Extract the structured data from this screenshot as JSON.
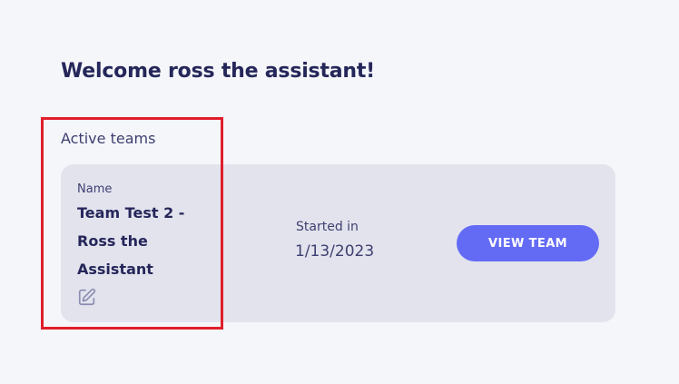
{
  "header": {
    "welcome": "Welcome ross the assistant!"
  },
  "active_teams": {
    "section_title": "Active teams",
    "teams": [
      {
        "name_label": "Name",
        "name": "Team Test 2 - Ross the Assistant",
        "edit_icon": "edit-pencil-icon",
        "started_label": "Started in",
        "started_date": "1/13/2023",
        "action_label": "VIEW TEAM"
      }
    ]
  },
  "colors": {
    "background": "#f5f6fa",
    "card": "#e3e3ee",
    "heading": "#25275a",
    "accent": "#636bf5",
    "highlight": "#e01e2b"
  }
}
